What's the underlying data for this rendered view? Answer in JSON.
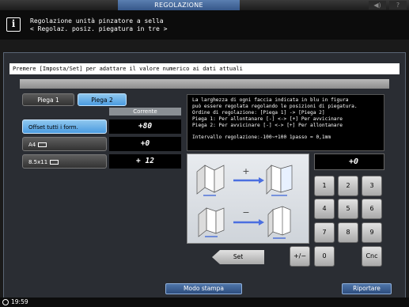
{
  "window": {
    "title": "REGOLAZIONE"
  },
  "top_icons": [
    "speaker-icon",
    "help-icon"
  ],
  "header": {
    "line1": "Regolazione unità pinzatore a sella",
    "line2": "< Regolaz. posiz. piegatura in tre >"
  },
  "dialog": {
    "instruction": "Premere [Imposta/Set] per adattare il valore numerico ai dati attuali",
    "tabs": [
      {
        "label": "Piega 1",
        "selected": false
      },
      {
        "label": "Piega 2",
        "selected": true
      }
    ],
    "column_header": "Corrente",
    "rows": [
      {
        "label": "Offset tutti i form.",
        "value": "+80",
        "selected": true
      },
      {
        "label": "A4",
        "icon": "paper-landscape-icon",
        "value": "+0",
        "selected": false
      },
      {
        "label": "8.5x11",
        "icon": "paper-landscape-icon",
        "value": "+ 12",
        "selected": false
      }
    ],
    "info": {
      "lines": [
        "La larghezza di ogni faccia indicata in blu in figura",
        "può essere regolata regolando le posizioni di piegatura.",
        "Ordine di regolazione: [Piega 1] -> [Piega 2]",
        "Piega 1: Per allontanare [-]  <->  [+] Per avvicinare",
        "Piega 2: Per avvicinare [-]  <->  [+] Per allontanare"
      ],
      "range": "Intervallo regolazione:-100~+100 1passo = 0,1mm"
    },
    "illustration": {
      "plus_sign": "+",
      "minus_sign": "−"
    },
    "input_value": "+0",
    "keypad": {
      "keys": [
        "1",
        "2",
        "3",
        "4",
        "5",
        "6",
        "7",
        "8",
        "9"
      ],
      "plus_minus": "+/−",
      "zero": "0",
      "clear": "Cnc"
    },
    "set_button": "Set"
  },
  "footer": {
    "modo_stampa": "Modo stampa",
    "riportare": "Riportare"
  },
  "status": {
    "time": "19:59"
  },
  "colors": {
    "accent_blue": "#4b9be0",
    "title_blue": "#36578a"
  }
}
